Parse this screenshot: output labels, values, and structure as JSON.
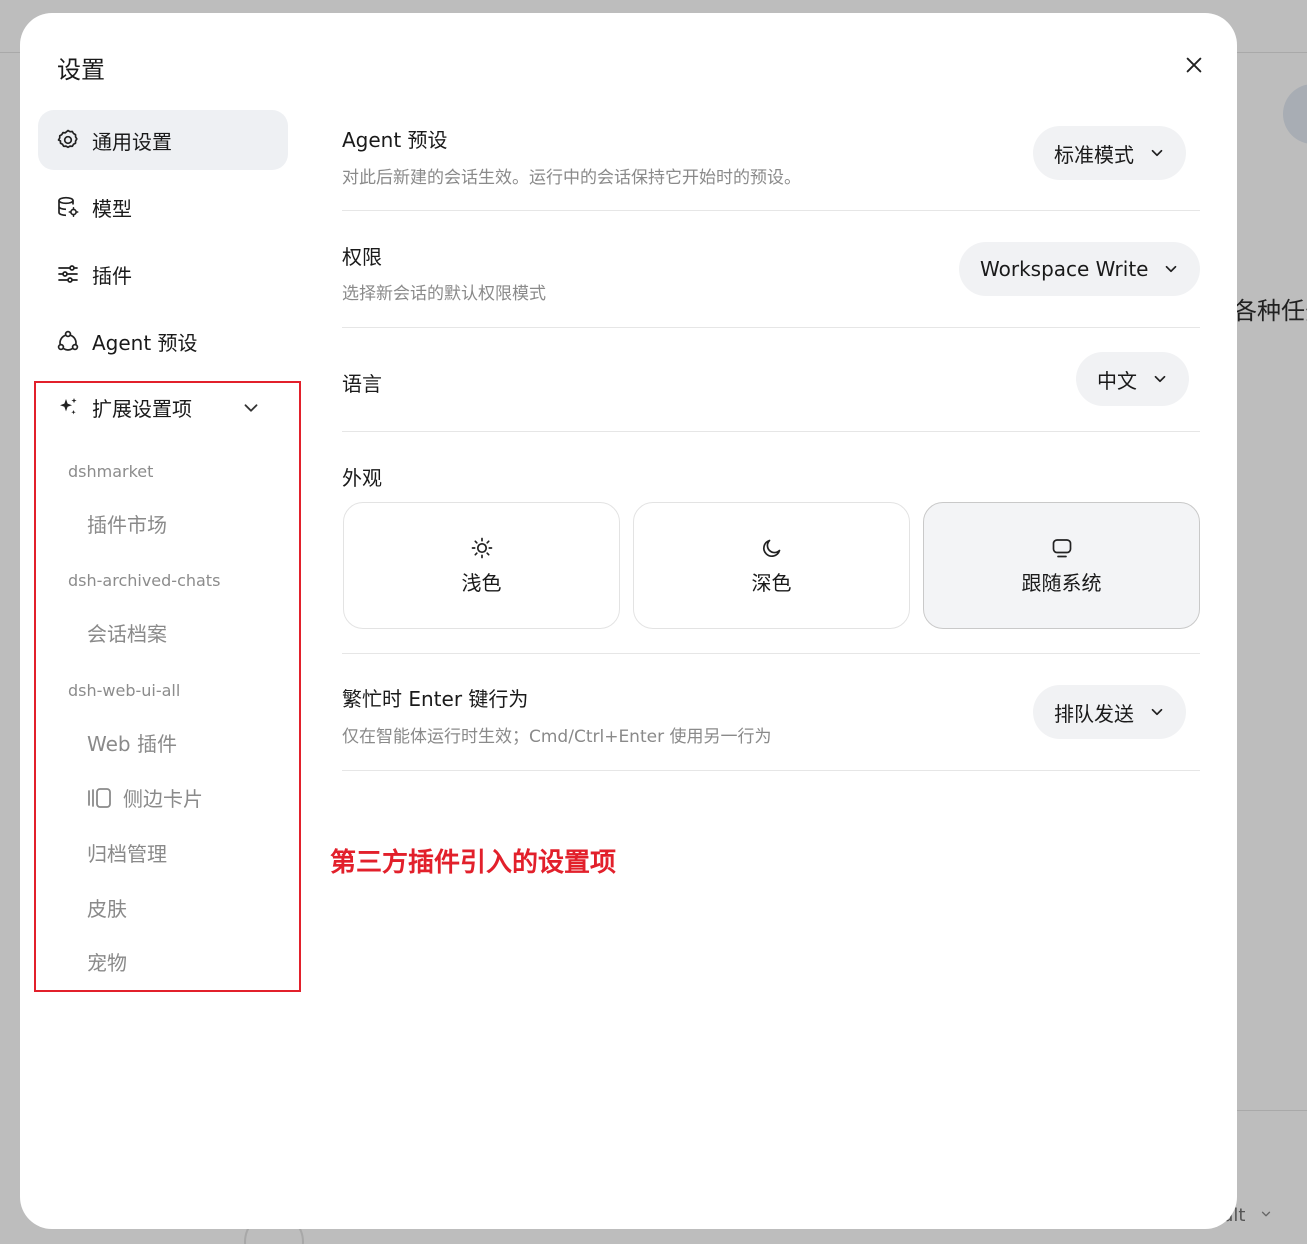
{
  "background": {
    "partial_text": "各种任务",
    "dropdown_text": "ult"
  },
  "modal": {
    "title": "设置"
  },
  "sidebar": {
    "items": [
      {
        "label": "通用设置",
        "icon": "gear-icon"
      },
      {
        "label": "模型",
        "icon": "database-icon"
      },
      {
        "label": "插件",
        "icon": "sliders-icon"
      },
      {
        "label": "Agent 预设",
        "icon": "agent-icon"
      },
      {
        "label": "扩展设置项",
        "icon": "sparkle-icon"
      }
    ],
    "extensions": [
      {
        "group": "dshmarket",
        "items": [
          "插件市场"
        ]
      },
      {
        "group": "dsh-archived-chats",
        "items": [
          "会话档案"
        ]
      },
      {
        "group": "dsh-web-ui-all",
        "items": [
          "Web 插件",
          "侧边卡片",
          "归档管理",
          "皮肤",
          "宠物"
        ]
      }
    ]
  },
  "annotation": {
    "label": "第三方插件引入的设置项",
    "color": "#e2202b"
  },
  "settings": {
    "agent_preset": {
      "title": "Agent 预设",
      "description": "对此后新建的会话生效。运行中的会话保持它开始时的预设。",
      "value": "标准模式"
    },
    "permission": {
      "title": "权限",
      "description": "选择新会话的默认权限模式",
      "value": "Workspace Write"
    },
    "language": {
      "title": "语言",
      "value": "中文"
    },
    "appearance": {
      "title": "外观",
      "options": [
        {
          "label": "浅色",
          "icon": "sun-icon"
        },
        {
          "label": "深色",
          "icon": "moon-icon"
        },
        {
          "label": "跟随系统",
          "icon": "monitor-icon"
        }
      ],
      "selected": "跟随系统"
    },
    "busy_enter": {
      "title": "繁忙时 Enter 键行为",
      "description": "仅在智能体运行时生效；Cmd/Ctrl+Enter 使用另一行为",
      "value": "排队发送"
    }
  }
}
